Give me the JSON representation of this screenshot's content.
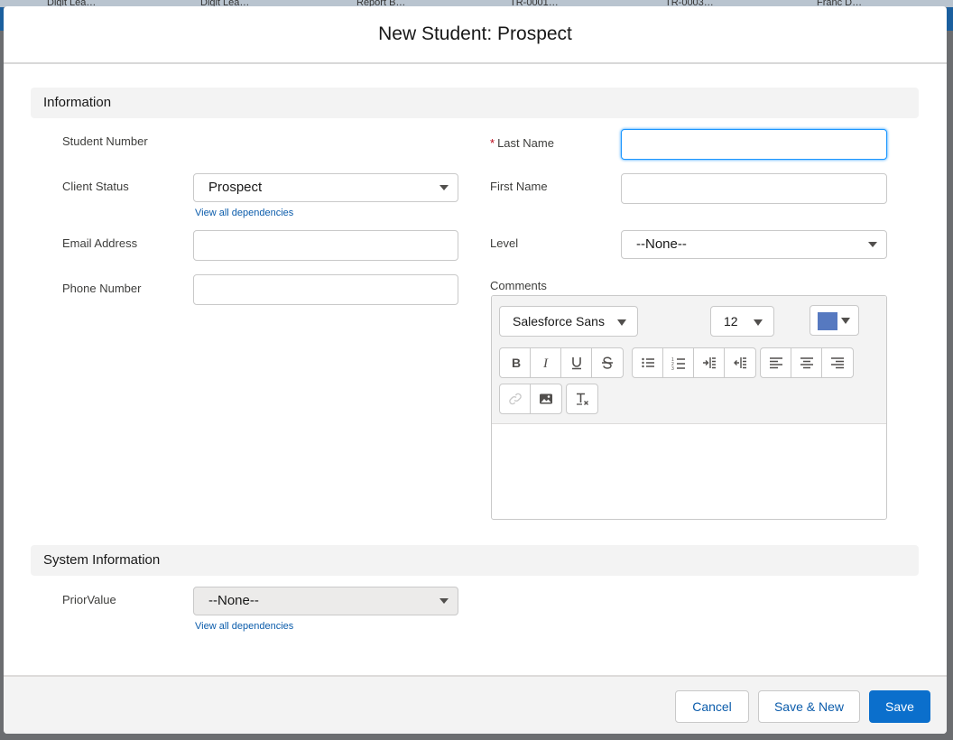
{
  "background_tabs": [
    {
      "label": "Digit Lea…"
    },
    {
      "label": "Digit Lea…"
    },
    {
      "label": "Report B…"
    },
    {
      "label": "TR-0001…"
    },
    {
      "label": "TR-0003…"
    },
    {
      "label": "Franc D…"
    }
  ],
  "modal": {
    "title": "New Student: Prospect"
  },
  "information": {
    "section_title": "Information",
    "student_number_label": "Student Number",
    "client_status_label": "Client Status",
    "client_status_value": "Prospect",
    "client_status_dependencies_link": "View all dependencies",
    "email_label": "Email Address",
    "email_value": "",
    "phone_label": "Phone Number",
    "phone_value": "",
    "last_name_required_marker": "*",
    "last_name_label": "Last Name",
    "last_name_value": "",
    "first_name_label": "First Name",
    "first_name_value": "",
    "level_label": "Level",
    "level_value": "--None--",
    "comments_label": "Comments"
  },
  "editor": {
    "font_family_value": "Salesforce Sans",
    "font_size_value": "12",
    "text_color": "#5679c0",
    "format_buttons": [
      "bold-icon",
      "italic-icon",
      "underline-icon",
      "strikethrough-icon"
    ],
    "list_buttons": [
      "bulleted-list-icon",
      "numbered-list-icon",
      "indent-icon",
      "outdent-icon"
    ],
    "align_buttons": [
      "align-left-icon",
      "align-center-icon",
      "align-right-icon"
    ],
    "insert_buttons": [
      "link-icon",
      "image-icon"
    ],
    "clear_button": "remove-formatting-icon",
    "content": ""
  },
  "system_information": {
    "section_title": "System Information",
    "prior_value_label": "PriorValue",
    "prior_value_value": "--None--",
    "prior_value_dependencies_link": "View all dependencies"
  },
  "footer": {
    "cancel_label": "Cancel",
    "save_new_label": "Save & New",
    "save_label": "Save"
  },
  "colors": {
    "brand_button": "#0b6fcc",
    "link": "#0b5cab",
    "required": "#ba0517",
    "focus": "#1b96ff"
  }
}
